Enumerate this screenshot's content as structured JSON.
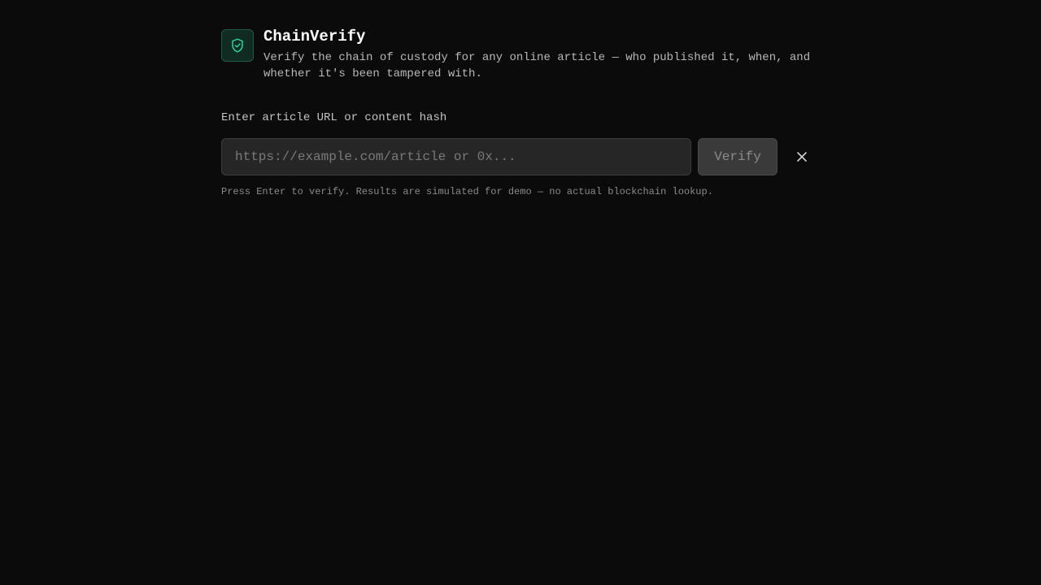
{
  "app": {
    "title": "ChainVerify",
    "subtitle": "Verify the chain of custody for any online article — who published it, when, and whether it's been tampered with.",
    "logo_icon": "shield-check-icon",
    "accent_color": "#2fd39a"
  },
  "form": {
    "label": "Enter article URL or content hash",
    "input_value": "",
    "input_placeholder": "https://example.com/article or 0x...",
    "verify_label": "Verify",
    "clear_icon": "close-icon",
    "hint": "Press Enter to verify. Results are simulated for demo — no actual blockchain lookup."
  }
}
